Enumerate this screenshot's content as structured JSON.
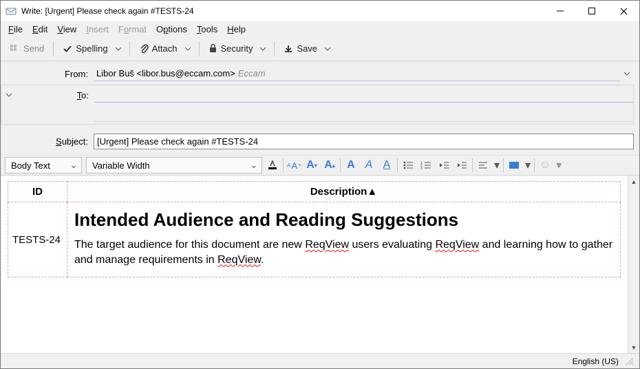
{
  "window": {
    "title": "Write: [Urgent] Please check again #TESTS-24"
  },
  "menu": {
    "file": "File",
    "edit": "Edit",
    "view": "View",
    "insert": "Insert",
    "format": "Format",
    "options": "Options",
    "tools": "Tools",
    "help": "Help"
  },
  "toolbar": {
    "send": "Send",
    "spelling": "Spelling",
    "attach": "Attach",
    "security": "Security",
    "save": "Save"
  },
  "headers": {
    "from_label": "From:",
    "to_label": "To:",
    "subject_label": "Subject:",
    "from_identity": "Libor Buš <libor.bus@eccam.com>",
    "from_account": "Eccam",
    "to_value": "",
    "subject_value": "[Urgent] Please check again #TESTS-24"
  },
  "format": {
    "paragraph_style": "Body Text",
    "font_family": "Variable Width"
  },
  "body_table": {
    "col_id": "ID",
    "col_desc": "Description",
    "row": {
      "id": "TESTS-24",
      "heading": "Intended Audience and Reading Suggestions",
      "p_pre1": "The target audience for this document are new ",
      "w1": "ReqView",
      "p_mid1": " users evaluating ",
      "w2": "ReqView",
      "p_mid2": " and learning how to gather and manage requirements in ",
      "w3": "ReqView",
      "p_post": "."
    }
  },
  "status": {
    "language": "English (US)"
  }
}
